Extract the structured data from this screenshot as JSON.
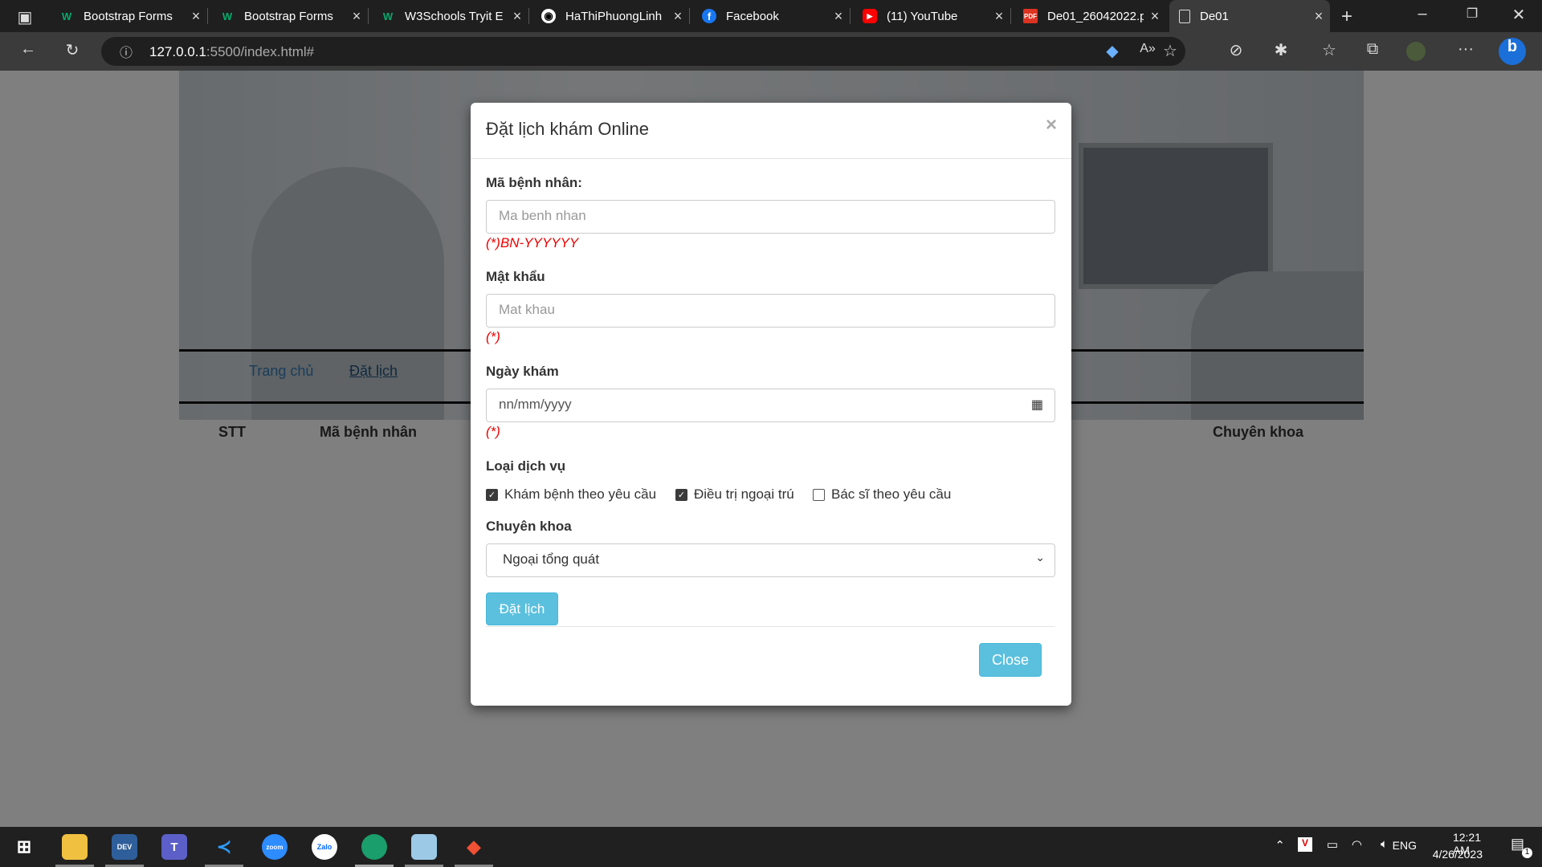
{
  "browser": {
    "tabs": [
      {
        "title": "Bootstrap Forms",
        "icon": "w3schools-icon"
      },
      {
        "title": "Bootstrap Forms",
        "icon": "w3schools-icon"
      },
      {
        "title": "W3Schools Tryit E",
        "icon": "w3schools-icon"
      },
      {
        "title": "HaThiPhuongLinh",
        "icon": "github-icon"
      },
      {
        "title": "Facebook",
        "icon": "facebook-icon"
      },
      {
        "title": "(11) YouTube",
        "icon": "youtube-icon"
      },
      {
        "title": "De01_26042022.p",
        "icon": "pdf-icon"
      },
      {
        "title": "De01",
        "icon": "page-icon"
      }
    ],
    "url_host": "127.0.0.1",
    "url_rest": ":5500/index.html#"
  },
  "page": {
    "nav": {
      "home": "Trang chủ",
      "booking": "Đặt lịch"
    },
    "table_headers": {
      "stt": "STT",
      "patient_id": "Mã bệnh nhân",
      "specialty": "Chuyên khoa"
    }
  },
  "modal": {
    "title": "Đặt lịch khám Online",
    "close_symbol": "×",
    "patient_id": {
      "label": "Mã bệnh nhân:",
      "placeholder": "Ma benh nhan",
      "hint": "(*)BN-YYYYYY"
    },
    "password": {
      "label": "Mật khẩu",
      "placeholder": "Mat khau",
      "hint": "(*)"
    },
    "date": {
      "label": "Ngày khám",
      "placeholder": "nn/mm/yyyy",
      "hint": "(*)"
    },
    "service": {
      "label": "Loại dịch vụ",
      "options": [
        {
          "label": "Khám bệnh theo yêu cầu",
          "checked": true
        },
        {
          "label": "Điều trị ngoại trú",
          "checked": true
        },
        {
          "label": "Bác sĩ theo yêu cầu",
          "checked": false
        }
      ]
    },
    "specialty": {
      "label": "Chuyên khoa",
      "selected": "Ngoại tổng quát"
    },
    "submit_label": "Đặt lịch",
    "close_label": "Close"
  },
  "taskbar": {
    "apps": [
      "File Explorer",
      "DEV",
      "Teams",
      "VS Code",
      "zoom",
      "Zalo",
      "Edge",
      "Notepad",
      "Git"
    ],
    "tray": {
      "language": "ENG",
      "time": "12:21 AM",
      "date": "4/26/2023",
      "notifications": "1"
    }
  },
  "colors": {
    "accent": "#5bc0de",
    "hint_red": "#ee0000",
    "link": "#337ab7"
  }
}
